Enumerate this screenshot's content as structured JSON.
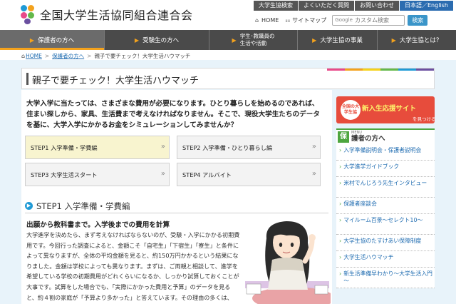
{
  "header": {
    "site_title": "全国大学生活協同組合連合会",
    "util_buttons": [
      "大学生協検索",
      "よくいただく質問",
      "お問い合わせ",
      "日本語／English"
    ],
    "home_link": "HOME",
    "sitemap_link": "サイトマップ",
    "search": {
      "brand": "Google",
      "placeholder": "カスタム検索"
    },
    "search_button": "検索"
  },
  "nav": {
    "items": [
      {
        "label": "保護者の方へ",
        "active": true
      },
      {
        "label": "受験生の方へ",
        "active": false
      },
      {
        "line1": "学生･教職員の",
        "line2": "生活や活動",
        "active": false
      },
      {
        "label": "大学生協の事業",
        "active": false
      },
      {
        "label": "大学生協とは？",
        "active": false
      }
    ]
  },
  "breadcrumb": {
    "home": "HOME",
    "parent": "保護者の方へ",
    "current": "親子で要チェック！大学生活ハウマッチ",
    "separator": ">"
  },
  "page": {
    "title": "親子で要チェック！大学生活ハウマッチ",
    "stripe_colors": [
      "#e84a8a",
      "#f3a21d",
      "#f5d21a",
      "#63b84a",
      "#1f9ad6",
      "#6a4fa0"
    ],
    "intro": "大学入学に当たっては、さまざまな費用が必要になります。ひとり暮らしを始めるのであれば、住まい探しから、家具、生活費まで考えなければなりません。そこで、現役大学生たちのデータを基に、大学入学にかかるお金をシミュレーションしてみませんか？",
    "steps": [
      {
        "label": "STEP1 入学準備・学費編",
        "active": true
      },
      {
        "label": "STEP2 入学準備・ひとり暮らし編",
        "active": false
      },
      {
        "label": "STEP3 大学生活スタート",
        "active": false
      },
      {
        "label": "STEP4 アルバイト",
        "active": false
      }
    ],
    "section_title": "STEP1 入学準備・学費編",
    "sub_title": "出願から教科書まで。入学後までの費用を計算",
    "body": "大学進学を決めたら、まず考えなければならないのが、受験・入学にかかる初期費用です。今回行った調査によると、金額こそ「自宅生」「下宿生」「寮生」と条件によって異なりますが、全体の平均金額を見ると、約150万円かかるという結果になりました。金額は学校によっても異なります。まずは、ご両親と相談して、進学を希望している学校の初期費用がどれくらいになるか、しっかり試算しておくことが大事です。試算をした場合でも、「実際にかかった費用と予算」のデータを見ると、約４割の家庭が「予算より多かった」と答えています。その理由の多くは、「必要なものがあった」という"
  },
  "sidebar": {
    "banner": {
      "circle": "全国の大学生協",
      "line_pre": "",
      "line_em": "新入生応援サイト",
      "line_post": "",
      "line_sub": "を見つける"
    },
    "menu_label": "MENU",
    "head_icon": "保",
    "head_title": "護者の方へ",
    "items": [
      "入学準備説明会・保護者説明会",
      "大学進学ガイドブック",
      "米村でんじろう先生インタビュー",
      "保護者座談会",
      "マイルーム百景～セレクト10～",
      "大学生協のたすけあい保障制度",
      "大学生活ハウマッチ",
      "新生活準備早わかり～大学生活入門～"
    ]
  }
}
